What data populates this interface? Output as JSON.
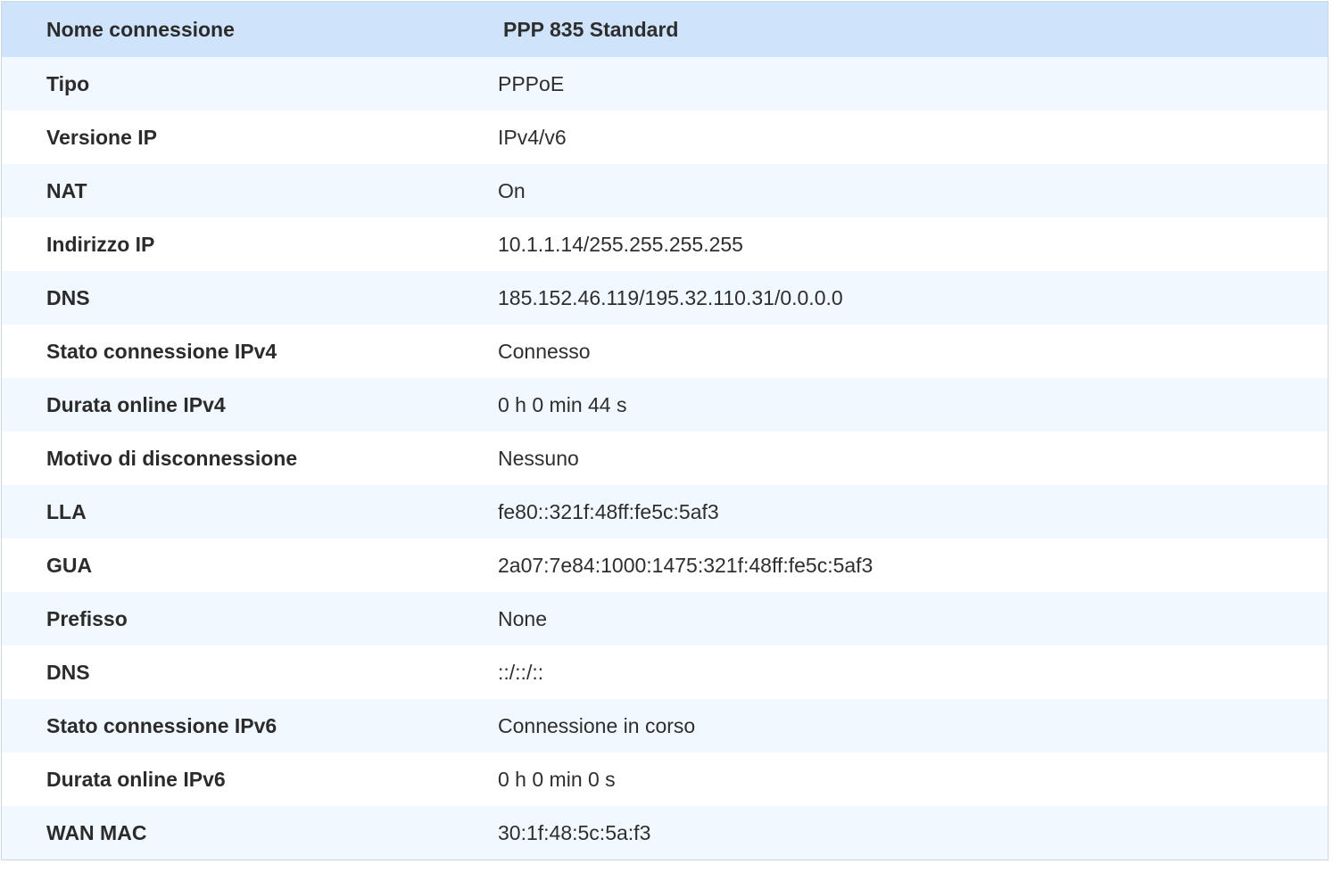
{
  "header": {
    "label": "Nome connessione",
    "value": "PPP 835 Standard"
  },
  "rows": [
    {
      "label": "Tipo",
      "value": "PPPoE"
    },
    {
      "label": "Versione IP",
      "value": "IPv4/v6"
    },
    {
      "label": "NAT",
      "value": "On"
    },
    {
      "label": "Indirizzo IP",
      "value": "10.1.1.14/255.255.255.255"
    },
    {
      "label": "DNS",
      "value": "185.152.46.119/195.32.110.31/0.0.0.0"
    },
    {
      "label": "Stato connessione IPv4",
      "value": "Connesso"
    },
    {
      "label": "Durata online IPv4",
      "value": "0 h 0 min 44 s"
    },
    {
      "label": "Motivo di disconnessione",
      "value": "Nessuno"
    },
    {
      "label": "LLA",
      "value": "fe80::321f:48ff:fe5c:5af3"
    },
    {
      "label": "GUA",
      "value": "2a07:7e84:1000:1475:321f:48ff:fe5c:5af3"
    },
    {
      "label": "Prefisso",
      "value": "None"
    },
    {
      "label": "DNS",
      "value": "::/::/::"
    },
    {
      "label": "Stato connessione IPv6",
      "value": "Connessione in corso"
    },
    {
      "label": "Durata online IPv6",
      "value": "0 h 0 min 0 s"
    },
    {
      "label": "WAN MAC",
      "value": "30:1f:48:5c:5a:f3"
    }
  ]
}
